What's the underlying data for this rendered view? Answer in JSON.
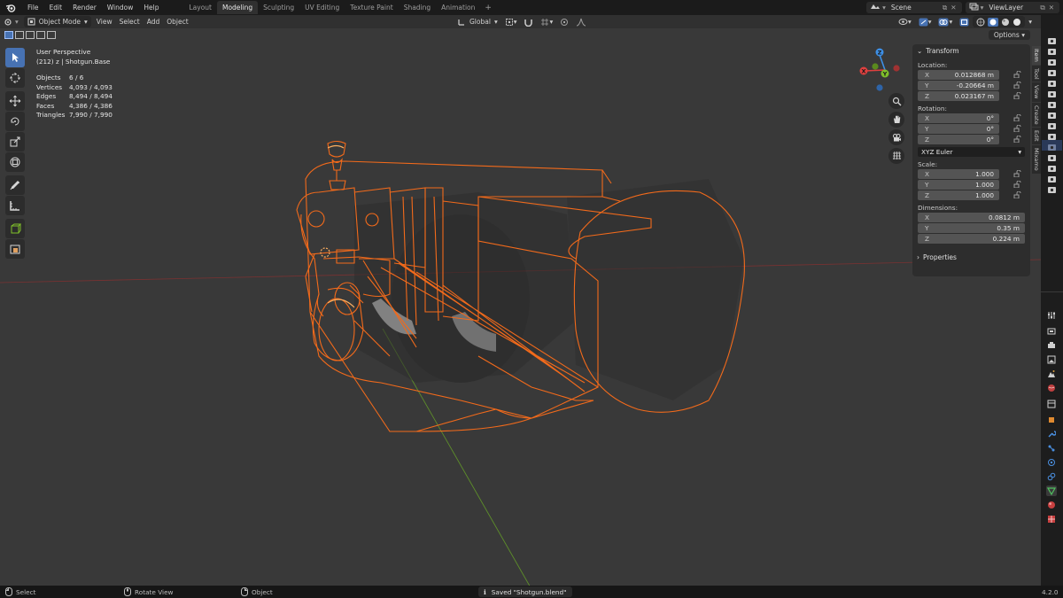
{
  "menubar": {
    "items": [
      "File",
      "Edit",
      "Render",
      "Window",
      "Help"
    ],
    "workspaces": [
      "Layout",
      "Modeling",
      "Sculpting",
      "UV Editing",
      "Texture Paint",
      "Shading",
      "Animation"
    ],
    "active_workspace": "Modeling",
    "add_workspace": "+",
    "scene": "Scene",
    "view_layer": "ViewLayer"
  },
  "header": {
    "mode": "Object Mode",
    "menus": [
      "View",
      "Select",
      "Add",
      "Object"
    ],
    "orientation": "Global",
    "options": "Options"
  },
  "viewport": {
    "perspective": "User Perspective",
    "object_info": "(212) z | Shotgun.Base",
    "stats": [
      {
        "k": "Objects",
        "v": "6 / 6"
      },
      {
        "k": "Vertices",
        "v": "4,093 / 4,093"
      },
      {
        "k": "Edges",
        "v": "8,494 / 8,494"
      },
      {
        "k": "Faces",
        "v": "4,386 / 4,386"
      },
      {
        "k": "Triangles",
        "v": "7,990 / 7,990"
      }
    ],
    "gizmo": {
      "x": "X",
      "y": "Y",
      "z": "Z"
    }
  },
  "npanel": {
    "title": "Transform",
    "location_label": "Location:",
    "location": [
      {
        "ax": "X",
        "v": "0.012868 m"
      },
      {
        "ax": "Y",
        "v": "-0.20664 m"
      },
      {
        "ax": "Z",
        "v": "0.023167 m"
      }
    ],
    "rotation_label": "Rotation:",
    "rotation": [
      {
        "ax": "X",
        "v": "0°"
      },
      {
        "ax": "Y",
        "v": "0°"
      },
      {
        "ax": "Z",
        "v": "0°"
      }
    ],
    "rotation_mode": "XYZ Euler",
    "scale_label": "Scale:",
    "scale": [
      {
        "ax": "X",
        "v": "1.000"
      },
      {
        "ax": "Y",
        "v": "1.000"
      },
      {
        "ax": "Z",
        "v": "1.000"
      }
    ],
    "dimensions_label": "Dimensions:",
    "dimensions": [
      {
        "ax": "X",
        "v": "0.0812 m"
      },
      {
        "ax": "Y",
        "v": "0.35 m"
      },
      {
        "ax": "Z",
        "v": "0.224 m"
      }
    ],
    "properties": "Properties",
    "side_tabs": [
      "Item",
      "Tool",
      "View",
      "Create",
      "Edit",
      "Mixamo"
    ]
  },
  "statusbar": {
    "select": "Select",
    "rotate": "Rotate View",
    "object": "Object",
    "saved": "Saved \"Shotgun.blend\"",
    "version": "4.2.0"
  },
  "colors": {
    "accent": "#4772b3",
    "wire": "#f26a1b",
    "axis_x": "#e0403f",
    "axis_y": "#7fbf2a",
    "axis_z": "#3d8fe6"
  }
}
